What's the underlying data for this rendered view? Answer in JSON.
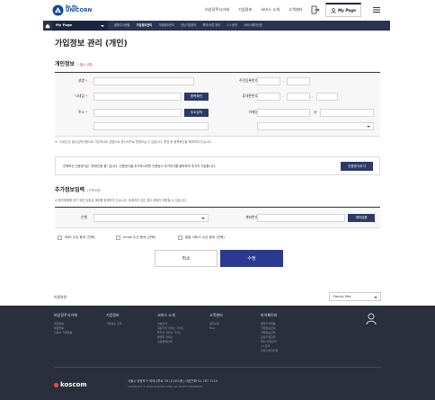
{
  "header": {
    "logo_line1": "Be My",
    "logo_line2": "UNICORN",
    "nav": [
      "비상장주식거래",
      "기업정보",
      "서비스 소개",
      "고객센터"
    ],
    "mypage_label": "My Page"
  },
  "subnav": {
    "current": "My Page",
    "links": [
      "발행주식현황",
      "가입정보관리",
      "거래정보관리",
      "관심기업관리",
      "쪽지/서류 관리",
      "1:1 문의",
      "서비스해지신청"
    ],
    "active_index": 1
  },
  "page": {
    "title": "가입정보 관리 (개인)"
  },
  "personal": {
    "section_title": "개인정보",
    "required_note": "* 필수 사항",
    "labels": {
      "name": "성명",
      "resident_no": "주민등록번호",
      "nickname": "닉네임",
      "mobile": "휴대폰번호",
      "address": "주소",
      "email": "이메일"
    },
    "dup_check_btn": "중복확인",
    "addr_search_btn": "주소검색",
    "email_at": "@",
    "phone_dash": "-",
    "note": "※ '닉네임'은 필수입력사항으로 기본적으로 성명으로 표시되므로 변경하실 수 있습니다. 변경 후 중복확인을 해야하여 주십시오."
  },
  "cert": {
    "text": "선택하신 인증방식은 \"휴대인증 중\" 입니다. 인증방식을 추가하시려면 인증방식 추가하기를 클릭하여 추가가 가능합니다.",
    "button": "인증방식추가"
  },
  "extra": {
    "section_title": "추가정보입력",
    "optional_note": "(선택사항)",
    "note": "※ 증권매매를 하기 위한 입출금 계좌를 등록하여 주십시오. 등록하지 않은 경우 매매가 제한될 수 있습니다.",
    "labels": {
      "bank": "은행",
      "account": "계좌번호"
    },
    "account_check_btn": "계좌검증",
    "consents": [
      "SMS 수신 동의 (선택)",
      "email 수신 동의 (선택)",
      "알림 서비스 수신 동의 (선택)"
    ]
  },
  "actions": {
    "cancel": "취소",
    "submit": "수정"
  },
  "bottom": {
    "policy": "이용약관",
    "family_site": "Family Site"
  },
  "footer": {
    "columns": [
      {
        "title": "비상장주식거래",
        "items": [
          "주문현황",
          "체결현황",
          "인증서 거래현황"
        ]
      },
      {
        "title": "기업정보",
        "items": [
          "기업정보 조회"
        ]
      },
      {
        "title": "서비스 소개",
        "items": [
          "이용안내",
          "회원가입 서비스 가이드",
          "투자자 서비스 가이드",
          "발행자 서비스",
          "인증방법안내"
        ]
      },
      {
        "title": "고객센터",
        "items": [
          "공지사항",
          "FAQ"
        ]
      },
      {
        "title": "마이페이지",
        "items": [
          "발행주식현황",
          "가입정보관리",
          "거래정보관리",
          "관심기업관리",
          "쪽지/서류관리",
          "1:1문의",
          "서비스해지신청"
        ]
      }
    ],
    "company": "koscom",
    "address": "서울시 영등포구 여의나루로 76 (주)코스콤   |   대표전화 02-767-7114",
    "copyright": "COPYRIGHT © 2019 KOSCOM CORP. ALL RIGHTS RESERVED."
  }
}
